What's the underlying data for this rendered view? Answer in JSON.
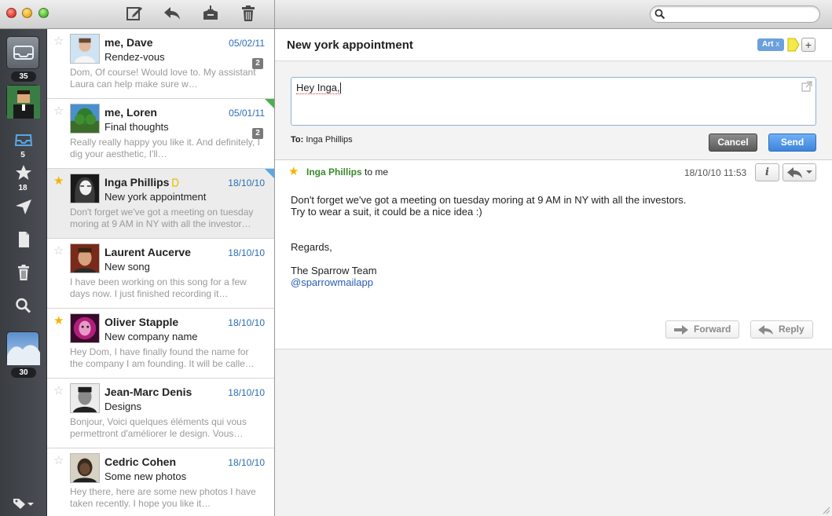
{
  "toolbar": {
    "compose_icon": "compose-icon",
    "reply_icon": "reply-icon",
    "archive_icon": "archive-icon",
    "trash_icon": "trash-icon"
  },
  "search": {
    "placeholder": "",
    "value": ""
  },
  "rail": {
    "accounts": [
      {
        "name": "mail-account-1",
        "badge": "35"
      },
      {
        "name": "mail-account-2",
        "badge": ""
      },
      {
        "name": "mail-account-3",
        "badge": "30"
      }
    ],
    "folders": [
      {
        "icon": "inbox-icon",
        "count": "5"
      },
      {
        "icon": "star-icon",
        "count": "18"
      },
      {
        "icon": "sent-icon",
        "count": ""
      },
      {
        "icon": "draft-icon",
        "count": ""
      },
      {
        "icon": "trash-icon",
        "count": ""
      },
      {
        "icon": "search-icon",
        "count": ""
      }
    ],
    "tag_icon": "tag-icon"
  },
  "messages": [
    {
      "from": "me, Dave",
      "date": "05/02/11",
      "subject": "Rendez-vous",
      "preview": "Dom, Of course! Would love to. My assistant Laura can help make sure w…",
      "count": "2",
      "starred": false,
      "corner": ""
    },
    {
      "from": "me, Loren",
      "date": "05/01/11",
      "subject": "Final thoughts",
      "preview": "Really really happy you like it. And definitely, I dig your aesthetic, I'll…",
      "count": "2",
      "starred": false,
      "corner": "#4caf50"
    },
    {
      "from": "Inga Phillips",
      "date": "18/10/10",
      "subject": "New york appointment",
      "preview": "Don't forget we've got a meeting on tuesday moring at 9 AM in NY with all the investor…",
      "count": "",
      "starred": true,
      "corner": "#5aa7e6"
    },
    {
      "from": "Laurent Aucerve",
      "date": "18/10/10",
      "subject": "New song",
      "preview": "I have been working on this song for a few days now. I just finished recording it…",
      "count": "",
      "starred": false,
      "corner": ""
    },
    {
      "from": "Oliver Stapple",
      "date": "18/10/10",
      "subject": "New company name",
      "preview": "Hey Dom, I have finally found the name for the company I am founding. It will be calle…",
      "count": "",
      "starred": true,
      "corner": ""
    },
    {
      "from": "Jean-Marc Denis",
      "date": "18/10/10",
      "subject": "Designs",
      "preview": "Bonjour, Voici quelques éléments qui vous permettront d'améliorer le design. Vous…",
      "count": "",
      "starred": false,
      "corner": ""
    },
    {
      "from": "Cedric Cohen",
      "date": "18/10/10",
      "subject": "Some new photos",
      "preview": "Hey there, here are some new photos I have taken recently. I hope you like it…",
      "count": "",
      "starred": false,
      "corner": ""
    }
  ],
  "pane": {
    "title": "New york appointment",
    "tag_label": "Art",
    "tag_remove": "x",
    "tag_add": "+",
    "compose": {
      "text": "Hey Inga,",
      "to_label": "To:",
      "to_value": "Inga Phillips",
      "cancel": "Cancel",
      "send": "Send"
    },
    "header": {
      "sender": "Inga Phillips",
      "recipient": "to me",
      "timestamp": "18/10/10 11:53",
      "info": "i"
    },
    "body": {
      "line1": "Don't forget we've got a meeting on tuesday moring at 9 AM in NY with all the investors.",
      "line2": "Try to wear a suit, it could be a nice idea :)",
      "regards": "Regards,",
      "signature": "The Sparrow Team",
      "link": "@sparrowmailapp"
    },
    "actions": {
      "forward": "Forward",
      "reply": "Reply"
    }
  },
  "colors": {
    "accent": "#2a6db5",
    "sender_green": "#3a8a2a",
    "star": "#f4b400",
    "send_blue": "#3d84db"
  }
}
